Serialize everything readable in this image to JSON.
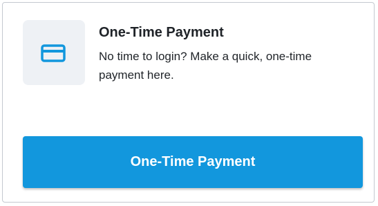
{
  "card": {
    "icon": "credit-card-icon",
    "title": "One-Time Payment",
    "description": "No time to login? Make a quick, one-time payment here.",
    "button_label": "One-Time Payment"
  },
  "colors": {
    "accent": "#1297dd",
    "icon_tile_bg": "#eef1f5",
    "text": "#1f2328",
    "border": "#c4c9d0"
  }
}
